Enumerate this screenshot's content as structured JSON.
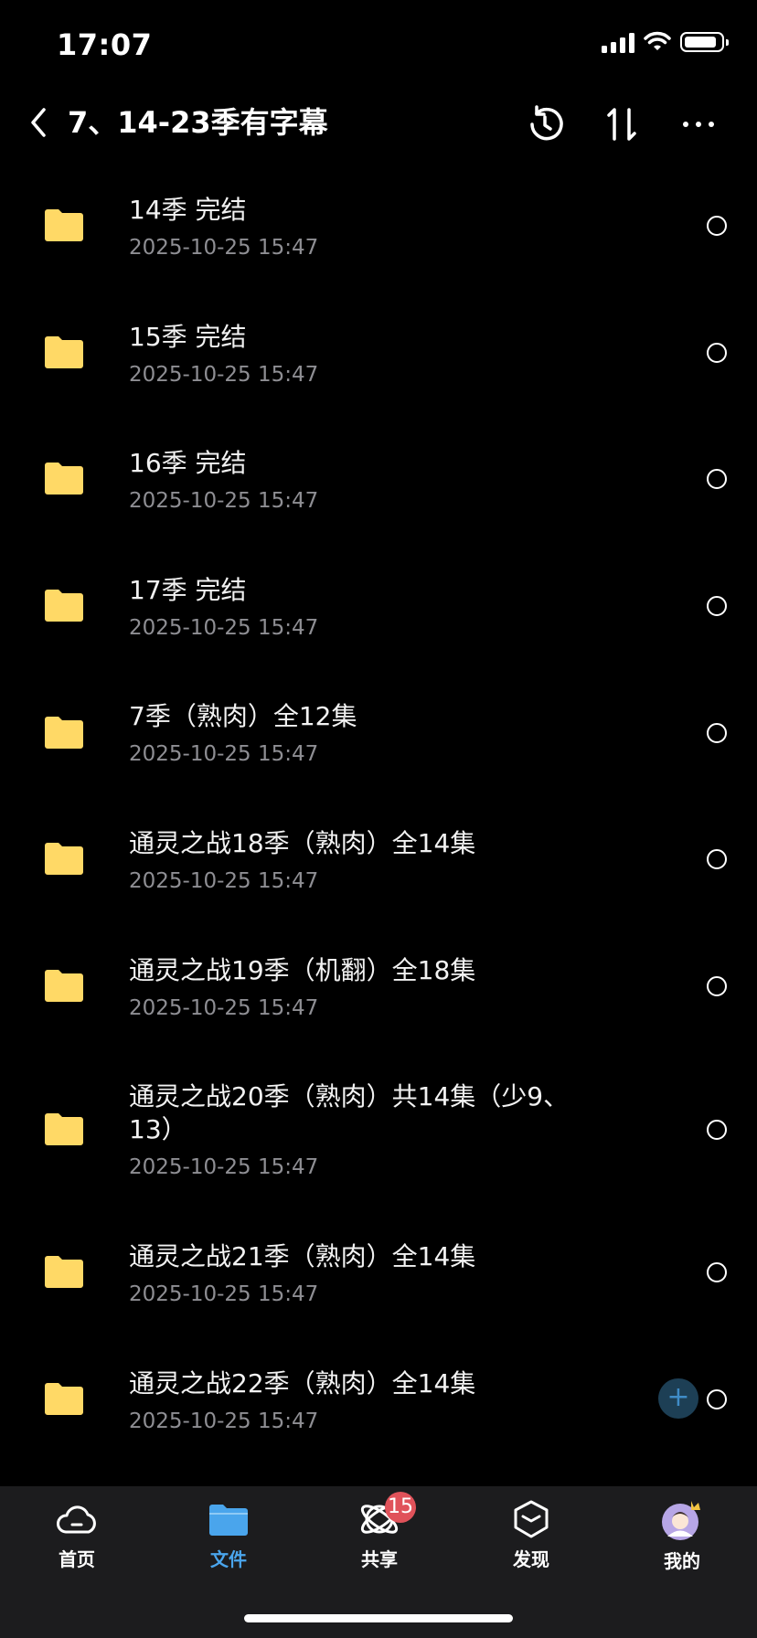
{
  "status": {
    "time": "17:07"
  },
  "header": {
    "title": "7、14-23季有字幕"
  },
  "items": [
    {
      "name": "14季 完结",
      "date": "2025-10-25 15:47"
    },
    {
      "name": "15季 完结",
      "date": "2025-10-25 15:47"
    },
    {
      "name": "16季 完结",
      "date": "2025-10-25 15:47"
    },
    {
      "name": "17季 完结",
      "date": "2025-10-25 15:47"
    },
    {
      "name": "7季（熟肉）全12集",
      "date": "2025-10-25 15:47"
    },
    {
      "name": "通灵之战18季（熟肉）全14集",
      "date": "2025-10-25 15:47"
    },
    {
      "name": "通灵之战19季（机翻）全18集",
      "date": "2025-10-25 15:47"
    },
    {
      "name": "通灵之战20季（熟肉）共14集（少9、13）",
      "date": "2025-10-25 15:47"
    },
    {
      "name": "通灵之战21季（熟肉）全14集",
      "date": "2025-10-25 15:47"
    },
    {
      "name": "通灵之战22季（熟肉）全14集",
      "date": "2025-10-25 15:47"
    }
  ],
  "tabs": [
    {
      "label": "首页",
      "icon": "cloud-icon"
    },
    {
      "label": "文件",
      "icon": "folder-icon",
      "active": true
    },
    {
      "label": "共享",
      "icon": "share-orbit-icon",
      "badge": "15"
    },
    {
      "label": "发现",
      "icon": "cube-icon"
    },
    {
      "label": "我的",
      "icon": "avatar-icon"
    }
  ],
  "colors": {
    "folder": "#FFD966",
    "accent": "#4AA5EC",
    "badge": "#E0525A",
    "background": "#000000",
    "tabbar": "#1C1C1E"
  }
}
